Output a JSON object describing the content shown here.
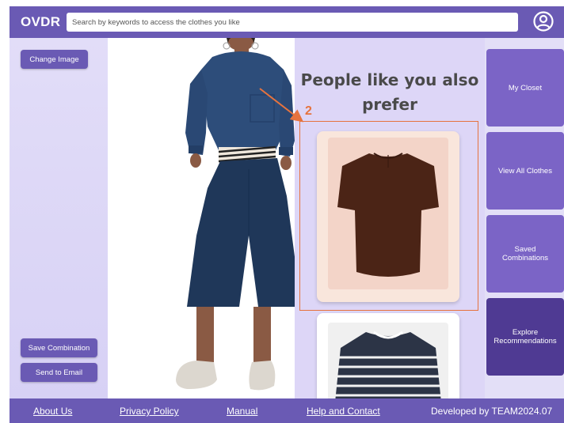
{
  "header": {
    "logo": "OVDR",
    "search_placeholder": "Search by keywords to access the clothes you like",
    "user_icon": "user-circle-icon"
  },
  "left_panel": {
    "change_image_label": "Change Image",
    "save_combination_label": "Save Combination",
    "send_email_label": "Send to Email"
  },
  "recommendations": {
    "title": "People like you also prefer",
    "annotation_number": "2",
    "items": [
      {
        "name": "brown short-sleeve blouse",
        "color": "#4b2416"
      },
      {
        "name": "navy striped long-sleeve top",
        "color": "#2c3446"
      }
    ]
  },
  "right_nav": {
    "items": [
      {
        "label": "My Closet"
      },
      {
        "label": "View All Clothes"
      },
      {
        "label": "Saved Combinations"
      },
      {
        "label": "Explore Recommendations"
      }
    ]
  },
  "footer": {
    "about": "About Us",
    "privacy": "Privacy Policy",
    "manual": "Manual",
    "help": "Help and Contact",
    "developed_by": "Developed by TEAM2024.07"
  },
  "colors": {
    "brand": "#6a5ab4",
    "tile": "#7b64c6",
    "tile_dark": "#4f3a93",
    "annotation": "#e6733e"
  }
}
